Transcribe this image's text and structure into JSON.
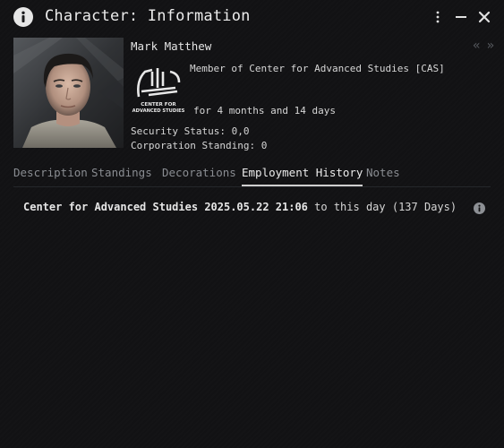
{
  "window": {
    "title": "Character: Information"
  },
  "character": {
    "name": "Mark Matthew",
    "member_of": "Member of Center for Advanced Studies [CAS]",
    "duration": "for 4 months and 14 days",
    "security_status": "Security Status: 0,0",
    "corporation_standing": "Corporation Standing: 0"
  },
  "corp_logo": {
    "line1": "CENTER FOR",
    "line2": "ADVANCED STUDIES"
  },
  "nav": {
    "back": "«",
    "forward": "»"
  },
  "tabs": [
    {
      "label": "Description"
    },
    {
      "label": "Standings"
    },
    {
      "label": "Decorations"
    },
    {
      "label": "Employment History"
    },
    {
      "label": "Notes"
    }
  ],
  "employment": [
    {
      "corporation": "Center for Advanced Studies",
      "date": "2025.05.22 21:06",
      "to_text": "to this day",
      "days": "(137 Days)"
    }
  ],
  "colors": {
    "background": "#121214",
    "text": "#d9d9d9",
    "tab_inactive": "#8a8d92",
    "tab_active": "#ececec"
  }
}
